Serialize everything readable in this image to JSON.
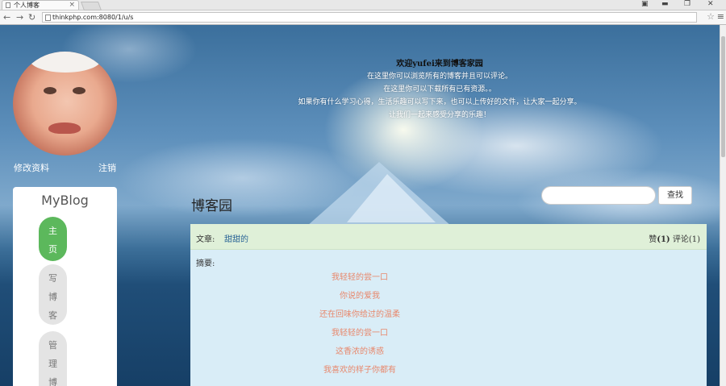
{
  "browser": {
    "tab_title": "个人博客",
    "url": "thinkphp.com:8080/1/u/s",
    "window_controls": [
      "▬",
      "❐",
      "✕"
    ]
  },
  "profile": {
    "edit_link": "修改资料",
    "logout_link": "注销"
  },
  "sidebar": {
    "brand": "MyBlog",
    "nav": [
      {
        "label_chars": [
          "主",
          "页"
        ],
        "active": true
      },
      {
        "label_chars": [
          "写",
          "博",
          "客"
        ],
        "active": false
      },
      {
        "label_chars": [
          "管",
          "理",
          "博"
        ],
        "active": false
      }
    ]
  },
  "welcome": {
    "title": "欢迎yufei来到博客家园",
    "lines": [
      "在这里你可以浏览所有的博客并且可以评论。",
      "在这里你可以下载所有已有资源。。",
      "如果你有什么学习心得，生活乐趣可以写下来，也可以上传好的文件，让大家一起分享。",
      "让我们一起来感受分享的乐趣！"
    ]
  },
  "main": {
    "page_title": "博客园",
    "search": {
      "placeholder": "",
      "button_label": "查找"
    }
  },
  "article": {
    "label": "文章:",
    "title": "甜甜的",
    "like_label": "赞",
    "like_count": "(1)",
    "comment_label": "评论",
    "comment_count": "(1)",
    "summary_label": "摘要:",
    "summary_lines": [
      "我轻轻的尝一口",
      "你说的爱我",
      "还在回味你给过的温柔",
      "我轻轻的尝一口",
      "这香浓的诱惑",
      "我喜欢的样子你都有"
    ]
  },
  "colors": {
    "accent_green": "#5cb85c",
    "panel_blue": "#d9edf7",
    "panel_head_green": "#dff0d8",
    "summary_text": "#e8876b"
  }
}
